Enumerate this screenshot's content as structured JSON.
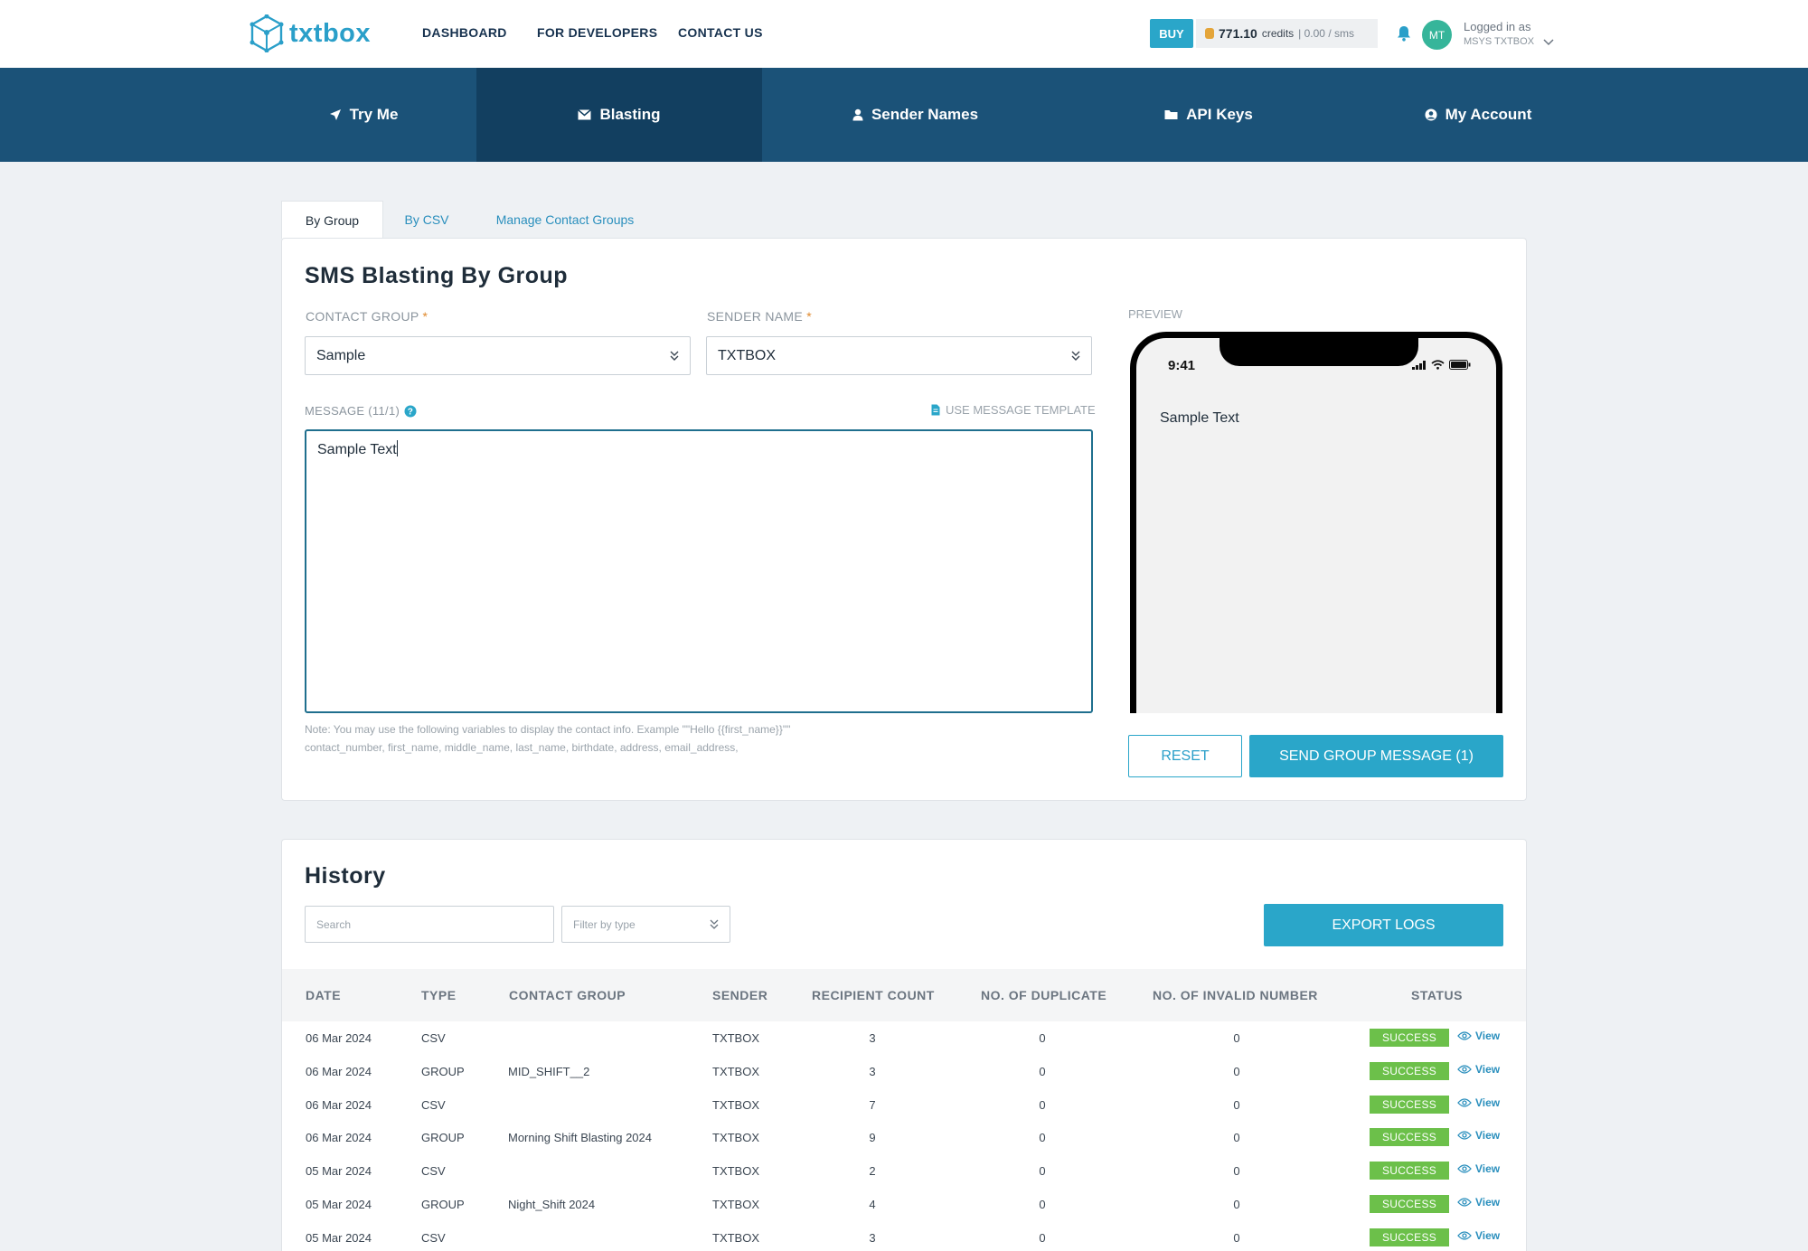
{
  "brand": {
    "name": "txtbox"
  },
  "topnav": {
    "dashboard": "DASHBOARD",
    "developers": "FOR DEVELOPERS",
    "contact": "CONTACT US"
  },
  "account": {
    "buy_label": "BUY",
    "credits_amount": "771.10",
    "credits_label": "credits",
    "rate": "| 0.00 / sms",
    "avatar_initials": "MT",
    "logged_in_label": "Logged in as",
    "user_name": "MSYS TXTBOX"
  },
  "mainnav": {
    "tabs": [
      {
        "label": "Try Me",
        "icon": "send-icon"
      },
      {
        "label": "Blasting",
        "icon": "envelope-icon",
        "active": true
      },
      {
        "label": "Sender Names",
        "icon": "person-icon"
      },
      {
        "label": "API Keys",
        "icon": "folder-icon"
      },
      {
        "label": "My Account",
        "icon": "account-circle-icon"
      }
    ]
  },
  "subtabs": {
    "by_group": "By Group",
    "by_csv": "By CSV",
    "manage": "Manage Contact Groups"
  },
  "blast": {
    "title": "SMS Blasting By Group",
    "contact_group_label": "CONTACT GROUP",
    "contact_group_value": "Sample",
    "sender_label": "SENDER NAME",
    "sender_value": "TXTBOX",
    "required_mark": "*",
    "message_label": "MESSAGE (11/1)",
    "template_link": "USE MESSAGE TEMPLATE",
    "message_value": "Sample Text",
    "note_line1": "Note: You may use the following variables to display the contact info. Example \"\"Hello {{first_name}}\"\"",
    "note_line2": "contact_number, first_name, middle_name, last_name, birthdate, address, email_address,",
    "preview_label": "PREVIEW",
    "phone_time": "9:41",
    "preview_text": "Sample Text",
    "reset_label": "RESET",
    "send_label": "SEND GROUP MESSAGE (1)"
  },
  "history": {
    "title": "History",
    "search_placeholder": "Search",
    "filter_placeholder": "Filter by type",
    "export_label": "EXPORT LOGS",
    "columns": [
      "DATE",
      "TYPE",
      "CONTACT GROUP",
      "SENDER",
      "RECIPIENT COUNT",
      "NO. OF DUPLICATE",
      "NO. OF INVALID NUMBER",
      "STATUS"
    ],
    "view_label": "View",
    "rows": [
      {
        "date": "06 Mar 2024",
        "type": "CSV",
        "group": "",
        "sender": "TXTBOX",
        "recipients": "3",
        "duplicates": "0",
        "invalid": "0",
        "status": "SUCCESS"
      },
      {
        "date": "06 Mar 2024",
        "type": "GROUP",
        "group": "MID_SHIFT__2",
        "sender": "TXTBOX",
        "recipients": "3",
        "duplicates": "0",
        "invalid": "0",
        "status": "SUCCESS"
      },
      {
        "date": "06 Mar 2024",
        "type": "CSV",
        "group": "",
        "sender": "TXTBOX",
        "recipients": "7",
        "duplicates": "0",
        "invalid": "0",
        "status": "SUCCESS"
      },
      {
        "date": "06 Mar 2024",
        "type": "GROUP",
        "group": "Morning Shift Blasting 2024",
        "sender": "TXTBOX",
        "recipients": "9",
        "duplicates": "0",
        "invalid": "0",
        "status": "SUCCESS"
      },
      {
        "date": "05 Mar 2024",
        "type": "CSV",
        "group": "",
        "sender": "TXTBOX",
        "recipients": "2",
        "duplicates": "0",
        "invalid": "0",
        "status": "SUCCESS"
      },
      {
        "date": "05 Mar 2024",
        "type": "GROUP",
        "group": "Night_Shift 2024",
        "sender": "TXTBOX",
        "recipients": "4",
        "duplicates": "0",
        "invalid": "0",
        "status": "SUCCESS"
      },
      {
        "date": "05 Mar 2024",
        "type": "CSV",
        "group": "",
        "sender": "TXTBOX",
        "recipients": "3",
        "duplicates": "0",
        "invalid": "0",
        "status": "SUCCESS"
      }
    ]
  },
  "colors": {
    "primary": "#2aa6c9",
    "nav": "#1b5278",
    "nav_active": "#123f60",
    "success": "#6cc04a"
  }
}
